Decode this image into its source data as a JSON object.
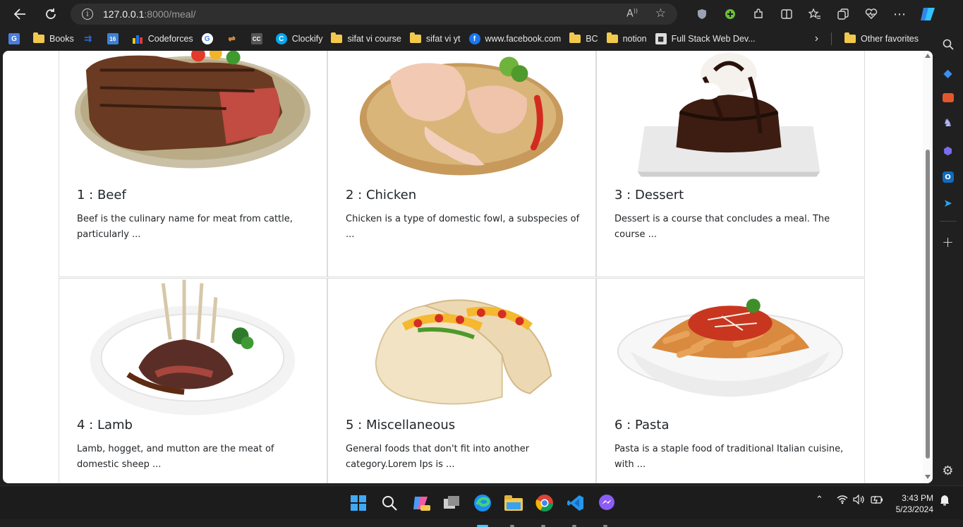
{
  "browser": {
    "url_host": "127.0.0.1",
    "url_rest": ":8000/meal/"
  },
  "bookmarks": [
    {
      "label": "",
      "icon": "google-translate-icon"
    },
    {
      "label": "Books",
      "icon": "folder-icon"
    },
    {
      "label": "",
      "icon": "blue-arrow-icon"
    },
    {
      "label": "",
      "icon": "calendar-icon"
    },
    {
      "label": "Codeforces",
      "icon": "codeforces-icon"
    },
    {
      "label": "",
      "icon": "google-icon"
    },
    {
      "label": "",
      "icon": "arrows-icon"
    },
    {
      "label": "",
      "icon": "cc-icon"
    },
    {
      "label": "Clockify",
      "icon": "clockify-icon"
    },
    {
      "label": "sifat vi course",
      "icon": "folder-icon"
    },
    {
      "label": "sifat vi yt",
      "icon": "folder-icon"
    },
    {
      "label": "www.facebook.com",
      "icon": "facebook-icon"
    },
    {
      "label": "BC",
      "icon": "folder-icon"
    },
    {
      "label": "notion",
      "icon": "folder-icon"
    },
    {
      "label": "Full Stack Web Dev...",
      "icon": "fullstack-icon"
    }
  ],
  "bookmarks_other": "Other favorites",
  "meals": [
    {
      "title": "1 : Beef",
      "desc": "Beef is the culinary name for meat from cattle, particularly ..."
    },
    {
      "title": "2 : Chicken",
      "desc": "Chicken is a type of domestic fowl, a subspecies of ..."
    },
    {
      "title": "3 : Dessert",
      "desc": "Dessert is a course that concludes a meal. The course ..."
    },
    {
      "title": "4 : Lamb",
      "desc": "Lamb, hogget, and mutton are the meat of domestic sheep ..."
    },
    {
      "title": "5 : Miscellaneous",
      "desc": "General foods that don't fit into another category.Lorem Ips is ..."
    },
    {
      "title": "6 : Pasta",
      "desc": "Pasta is a staple food of traditional Italian cuisine, with ..."
    }
  ],
  "clock": {
    "time": "3:43 PM",
    "date": "5/23/2024"
  }
}
